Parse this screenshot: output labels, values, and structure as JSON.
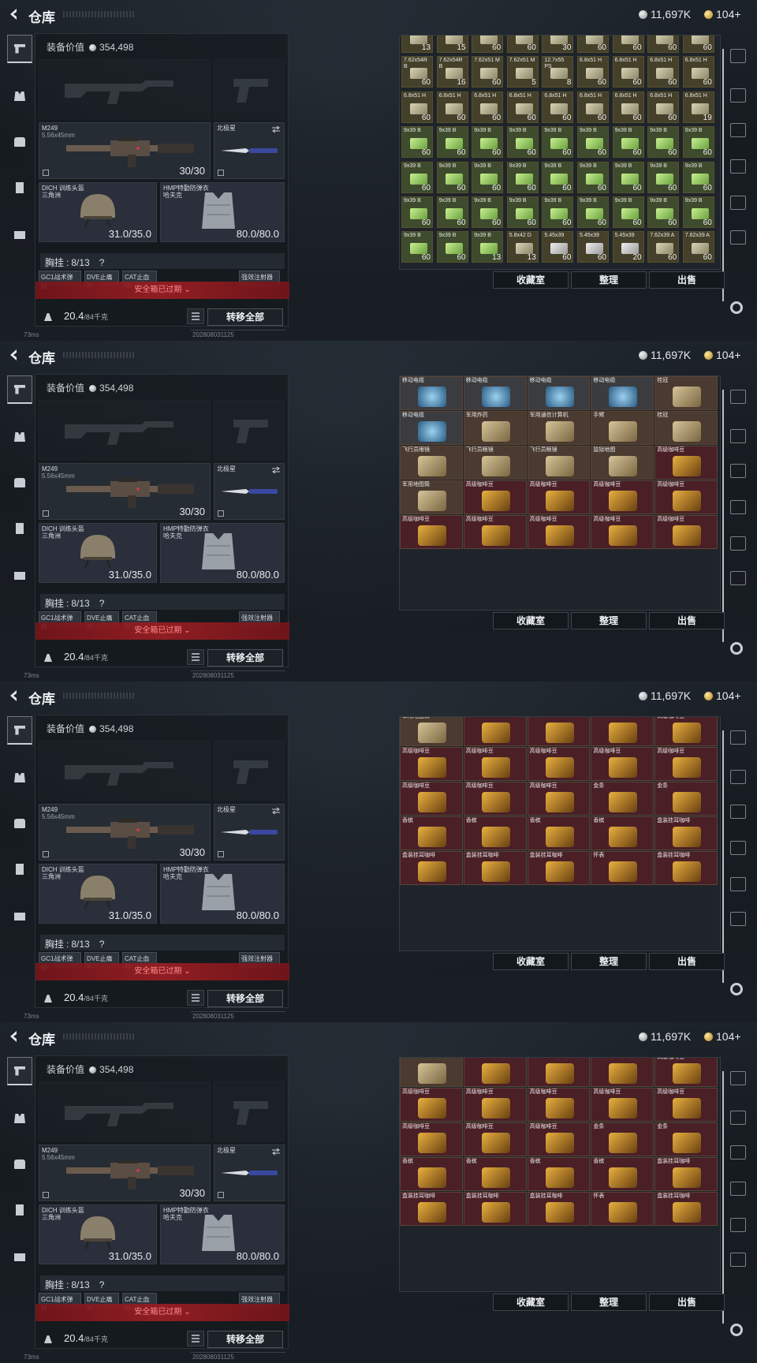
{
  "app": {
    "title": "仓库",
    "currency": {
      "coins": "11,697K",
      "gold": "104+"
    }
  },
  "gear": {
    "value_label": "装备价值",
    "value": "354,498",
    "primary_weapon": {
      "name": "M249",
      "caliber": "5.56x45mm",
      "ammo": "30/30"
    },
    "melee": {
      "name": "北极星"
    },
    "helmet": {
      "name": "DICH 训练头盔",
      "sub": "三角洲",
      "durability": "31.0/35.0"
    },
    "armor": {
      "name": "HMP特勤防弹衣",
      "sub": "哈夫克",
      "durability": "80.0/80.0"
    },
    "chest_rig": {
      "label": "胸挂",
      "capacity": "8/13",
      "help": "?"
    },
    "sub_slots": [
      "GC1战术弹挂",
      "DVE止痛片",
      "CAT止血带",
      "强效注射器"
    ],
    "safe_box_warning": "安全箱已过期",
    "weight": "20.4",
    "weight_max": "/84千克",
    "transfer_all": "转移全部"
  },
  "storage_actions": {
    "favorites": "收藏室",
    "organize": "整理",
    "sell": "出售"
  },
  "status": {
    "ping": "73ms",
    "build": "202808031125"
  },
  "frames": [
    {
      "kind": "ammo",
      "rows": [
        [
          {
            "n": "",
            "q": "13"
          },
          {
            "n": "",
            "q": "15"
          },
          {
            "n": "",
            "q": "60"
          },
          {
            "n": "",
            "q": "60"
          },
          {
            "n": "",
            "q": "30"
          },
          {
            "n": "",
            "q": "60"
          },
          {
            "n": "",
            "q": "60"
          },
          {
            "n": "",
            "q": "60"
          },
          {
            "n": "",
            "q": "60"
          }
        ],
        [
          {
            "n": "7.62x54R B",
            "q": "60"
          },
          {
            "n": "7.62x54R B",
            "q": "16"
          },
          {
            "n": "7.62x51 M",
            "q": "60"
          },
          {
            "n": "7.62x51 M",
            "q": "5"
          },
          {
            "n": "12.7x55 PS",
            "q": "8"
          },
          {
            "n": "6.8x51 H",
            "q": "60"
          },
          {
            "n": "6.8x51 H",
            "q": "60"
          },
          {
            "n": "6.8x51 H",
            "q": "60"
          },
          {
            "n": "6.8x51 H",
            "q": "60"
          }
        ],
        [
          {
            "n": "6.8x51 H",
            "q": "60"
          },
          {
            "n": "6.8x51 H",
            "q": "60"
          },
          {
            "n": "6.8x51 H",
            "q": "60"
          },
          {
            "n": "6.8x51 H",
            "q": "60"
          },
          {
            "n": "6.8x51 H",
            "q": "60"
          },
          {
            "n": "6.8x51 H",
            "q": "60"
          },
          {
            "n": "6.8x51 H",
            "q": "60"
          },
          {
            "n": "6.8x51 H",
            "q": "60"
          },
          {
            "n": "6.8x51 H",
            "q": "19"
          }
        ],
        [
          {
            "n": "9x39 B",
            "q": "60",
            "g": 1
          },
          {
            "n": "9x39 B",
            "q": "60",
            "g": 1
          },
          {
            "n": "9x39 B",
            "q": "60",
            "g": 1
          },
          {
            "n": "9x39 B",
            "q": "60",
            "g": 1
          },
          {
            "n": "9x39 B",
            "q": "60",
            "g": 1
          },
          {
            "n": "9x39 B",
            "q": "60",
            "g": 1
          },
          {
            "n": "9x39 B",
            "q": "60",
            "g": 1
          },
          {
            "n": "9x39 B",
            "q": "60",
            "g": 1
          },
          {
            "n": "9x39 B",
            "q": "60",
            "g": 1
          }
        ],
        [
          {
            "n": "9x39 B",
            "q": "60",
            "g": 1
          },
          {
            "n": "9x39 B",
            "q": "60",
            "g": 1
          },
          {
            "n": "9x39 B",
            "q": "60",
            "g": 1
          },
          {
            "n": "9x39 B",
            "q": "60",
            "g": 1
          },
          {
            "n": "9x39 B",
            "q": "60",
            "g": 1
          },
          {
            "n": "9x39 B",
            "q": "60",
            "g": 1
          },
          {
            "n": "9x39 B",
            "q": "60",
            "g": 1
          },
          {
            "n": "9x39 B",
            "q": "60",
            "g": 1
          },
          {
            "n": "9x39 B",
            "q": "60",
            "g": 1
          }
        ],
        [
          {
            "n": "9x39 B",
            "q": "60",
            "g": 1
          },
          {
            "n": "9x39 B",
            "q": "60",
            "g": 1
          },
          {
            "n": "9x39 B",
            "q": "60",
            "g": 1
          },
          {
            "n": "9x39 B",
            "q": "60",
            "g": 1
          },
          {
            "n": "9x39 B",
            "q": "60",
            "g": 1
          },
          {
            "n": "9x39 B",
            "q": "60",
            "g": 1
          },
          {
            "n": "9x39 B",
            "q": "60",
            "g": 1
          },
          {
            "n": "9x39 B",
            "q": "60",
            "g": 1
          },
          {
            "n": "9x39 B",
            "q": "60",
            "g": 1
          }
        ],
        [
          {
            "n": "9x39 B",
            "q": "60",
            "g": 1
          },
          {
            "n": "9x39 B",
            "q": "60",
            "g": 1
          },
          {
            "n": "9x39 B",
            "q": "13",
            "g": 1
          },
          {
            "n": "5.8x42 D",
            "q": "13"
          },
          {
            "n": "5.45x39",
            "q": "60",
            "s": 1
          },
          {
            "n": "5.45x39",
            "q": "60",
            "s": 1
          },
          {
            "n": "5.45x39",
            "q": "20",
            "s": 1
          },
          {
            "n": "7.62x39 A",
            "q": "60"
          },
          {
            "n": "7.62x39 A",
            "q": "60"
          }
        ]
      ]
    },
    {
      "kind": "items",
      "tiles": [
        {
          "n": "移动电缆",
          "c": "gray"
        },
        {
          "n": "移动电缆",
          "c": "gray"
        },
        {
          "n": "移动电缆",
          "c": "gray"
        },
        {
          "n": "移动电缆",
          "c": "gray"
        },
        {
          "n": "桂冠",
          "c": "brown"
        },
        {
          "n": "移动电缆",
          "c": "gray"
        },
        {
          "n": "军用炸药",
          "c": "brown"
        },
        {
          "n": "军用通信计算机",
          "c": "brown"
        },
        {
          "n": "手臂",
          "c": "brown"
        },
        {
          "n": "桂冠",
          "c": "brown"
        },
        {
          "n": "飞行员眼镜",
          "c": "brown"
        },
        {
          "n": "飞行员眼镜",
          "c": "brown"
        },
        {
          "n": "飞行员眼镜",
          "c": "brown"
        },
        {
          "n": "监狱地图",
          "c": "brown"
        },
        {
          "n": "高级咖啡豆",
          "c": "red"
        },
        {
          "n": "军用地图筒",
          "c": "brown"
        },
        {
          "n": "高级咖啡豆",
          "c": "red"
        },
        {
          "n": "高级咖啡豆",
          "c": "red"
        },
        {
          "n": "高级咖啡豆",
          "c": "red"
        },
        {
          "n": "高级咖啡豆",
          "c": "red"
        },
        {
          "n": "高级咖啡豆",
          "c": "red"
        },
        {
          "n": "高级咖啡豆",
          "c": "red"
        },
        {
          "n": "高级咖啡豆",
          "c": "red"
        },
        {
          "n": "高级咖啡豆",
          "c": "red"
        },
        {
          "n": "高级咖啡豆",
          "c": "red"
        }
      ]
    },
    {
      "kind": "valuables",
      "tiles": [
        {
          "n": "军用地图筒",
          "c": "brown"
        },
        {
          "n": "",
          "c": "red"
        },
        {
          "n": "",
          "c": "red"
        },
        {
          "n": "",
          "c": "red"
        },
        {
          "n": "高级咖啡豆",
          "c": "red"
        },
        {
          "n": "高级咖啡豆",
          "c": "red"
        },
        {
          "n": "高级咖啡豆",
          "c": "red"
        },
        {
          "n": "高级咖啡豆",
          "c": "red"
        },
        {
          "n": "高级咖啡豆",
          "c": "red"
        },
        {
          "n": "高级咖啡豆",
          "c": "red"
        },
        {
          "n": "高级咖啡豆",
          "c": "red"
        },
        {
          "n": "高级咖啡豆",
          "c": "red"
        },
        {
          "n": "高级咖啡豆",
          "c": "red"
        },
        {
          "n": "金条",
          "c": "red"
        },
        {
          "n": "金条",
          "c": "red"
        },
        {
          "n": "香槟",
          "c": "red"
        },
        {
          "n": "香槟",
          "c": "red"
        },
        {
          "n": "香槟",
          "c": "red"
        },
        {
          "n": "香槟",
          "c": "red"
        },
        {
          "n": "盒装挂耳咖啡",
          "c": "red"
        },
        {
          "n": "盒装挂耳咖啡",
          "c": "red"
        },
        {
          "n": "盒装挂耳咖啡",
          "c": "red"
        },
        {
          "n": "盒装挂耳咖啡",
          "c": "red"
        },
        {
          "n": "怀表",
          "c": "red"
        },
        {
          "n": "盒装挂耳咖啡",
          "c": "red"
        }
      ]
    },
    {
      "kind": "valuables",
      "tiles": [
        {
          "n": "",
          "c": "brown"
        },
        {
          "n": "",
          "c": "red"
        },
        {
          "n": "",
          "c": "red"
        },
        {
          "n": "",
          "c": "red"
        },
        {
          "n": "高级咖啡豆",
          "c": "red"
        },
        {
          "n": "高级咖啡豆",
          "c": "red"
        },
        {
          "n": "高级咖啡豆",
          "c": "red"
        },
        {
          "n": "高级咖啡豆",
          "c": "red"
        },
        {
          "n": "高级咖啡豆",
          "c": "red"
        },
        {
          "n": "高级咖啡豆",
          "c": "red"
        },
        {
          "n": "高级咖啡豆",
          "c": "red"
        },
        {
          "n": "高级咖啡豆",
          "c": "red"
        },
        {
          "n": "高级咖啡豆",
          "c": "red"
        },
        {
          "n": "金条",
          "c": "red"
        },
        {
          "n": "金条",
          "c": "red"
        },
        {
          "n": "香槟",
          "c": "red"
        },
        {
          "n": "香槟",
          "c": "red"
        },
        {
          "n": "香槟",
          "c": "red"
        },
        {
          "n": "香槟",
          "c": "red"
        },
        {
          "n": "盒装挂耳咖啡",
          "c": "red"
        },
        {
          "n": "盒装挂耳咖啡",
          "c": "red"
        },
        {
          "n": "盒装挂耳咖啡",
          "c": "red"
        },
        {
          "n": "盒装挂耳咖啡",
          "c": "red"
        },
        {
          "n": "怀表",
          "c": "red"
        },
        {
          "n": "盒装挂耳咖啡",
          "c": "red"
        }
      ]
    }
  ]
}
